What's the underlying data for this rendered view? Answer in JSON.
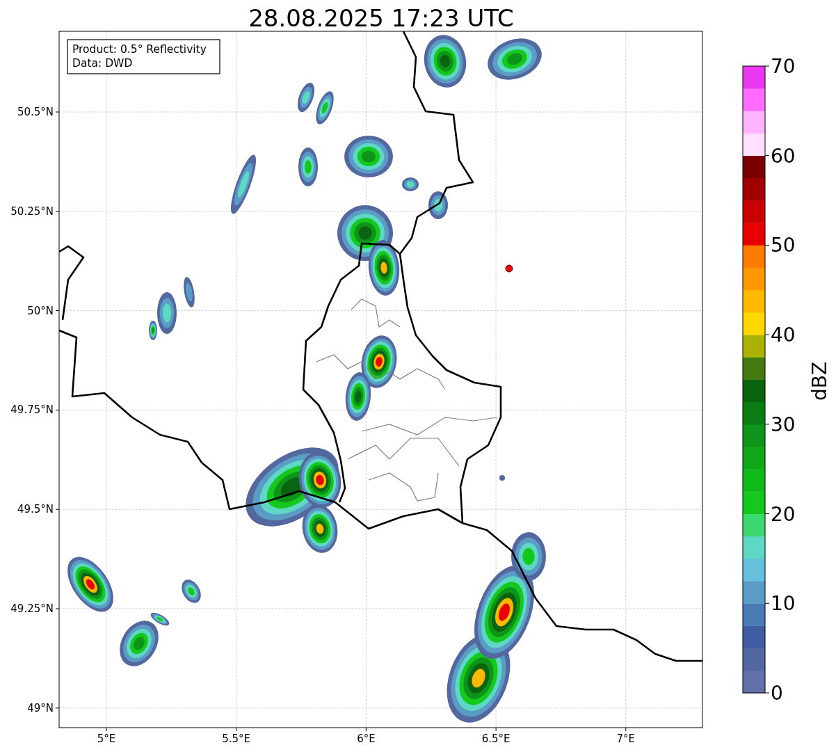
{
  "title": "28.08.2025 17:23 UTC",
  "info_box": [
    "Product: 0.5° Reflectivity",
    "Data: DWD"
  ],
  "x_ticks": [
    "5°E",
    "5.5°E",
    "6°E",
    "6.5°E",
    "7°E"
  ],
  "y_ticks": [
    "50.5°N",
    "50.25°N",
    "50°N",
    "49.75°N",
    "49.5°N",
    "49.25°N",
    "49°N"
  ],
  "colorbar": {
    "label": "dBZ",
    "ticks": [
      "70",
      "60",
      "50",
      "40",
      "30",
      "20",
      "10",
      "0"
    ],
    "bins": [
      {
        "color": "#6272a8"
      },
      {
        "color": "#52689e"
      },
      {
        "color": "#415da2"
      },
      {
        "color": "#4a7ab3"
      },
      {
        "color": "#5a9cc6"
      },
      {
        "color": "#66c0dc"
      },
      {
        "color": "#5ed8c4"
      },
      {
        "color": "#3cd870"
      },
      {
        "color": "#14c81e"
      },
      {
        "color": "#10b81c"
      },
      {
        "color": "#10a818"
      },
      {
        "color": "#0e9418"
      },
      {
        "color": "#0c7c14"
      },
      {
        "color": "#0a6410"
      },
      {
        "color": "#447a10"
      },
      {
        "color": "#aab206"
      },
      {
        "color": "#ffd800"
      },
      {
        "color": "#ffb800"
      },
      {
        "color": "#ff9800"
      },
      {
        "color": "#ff7c00"
      },
      {
        "color": "#e60000"
      },
      {
        "color": "#c80000"
      },
      {
        "color": "#a00000"
      },
      {
        "color": "#780000"
      },
      {
        "color": "#ffe0ff"
      },
      {
        "color": "#ffb4ff"
      },
      {
        "color": "#ff6cff"
      },
      {
        "color": "#e838f0"
      }
    ]
  }
}
